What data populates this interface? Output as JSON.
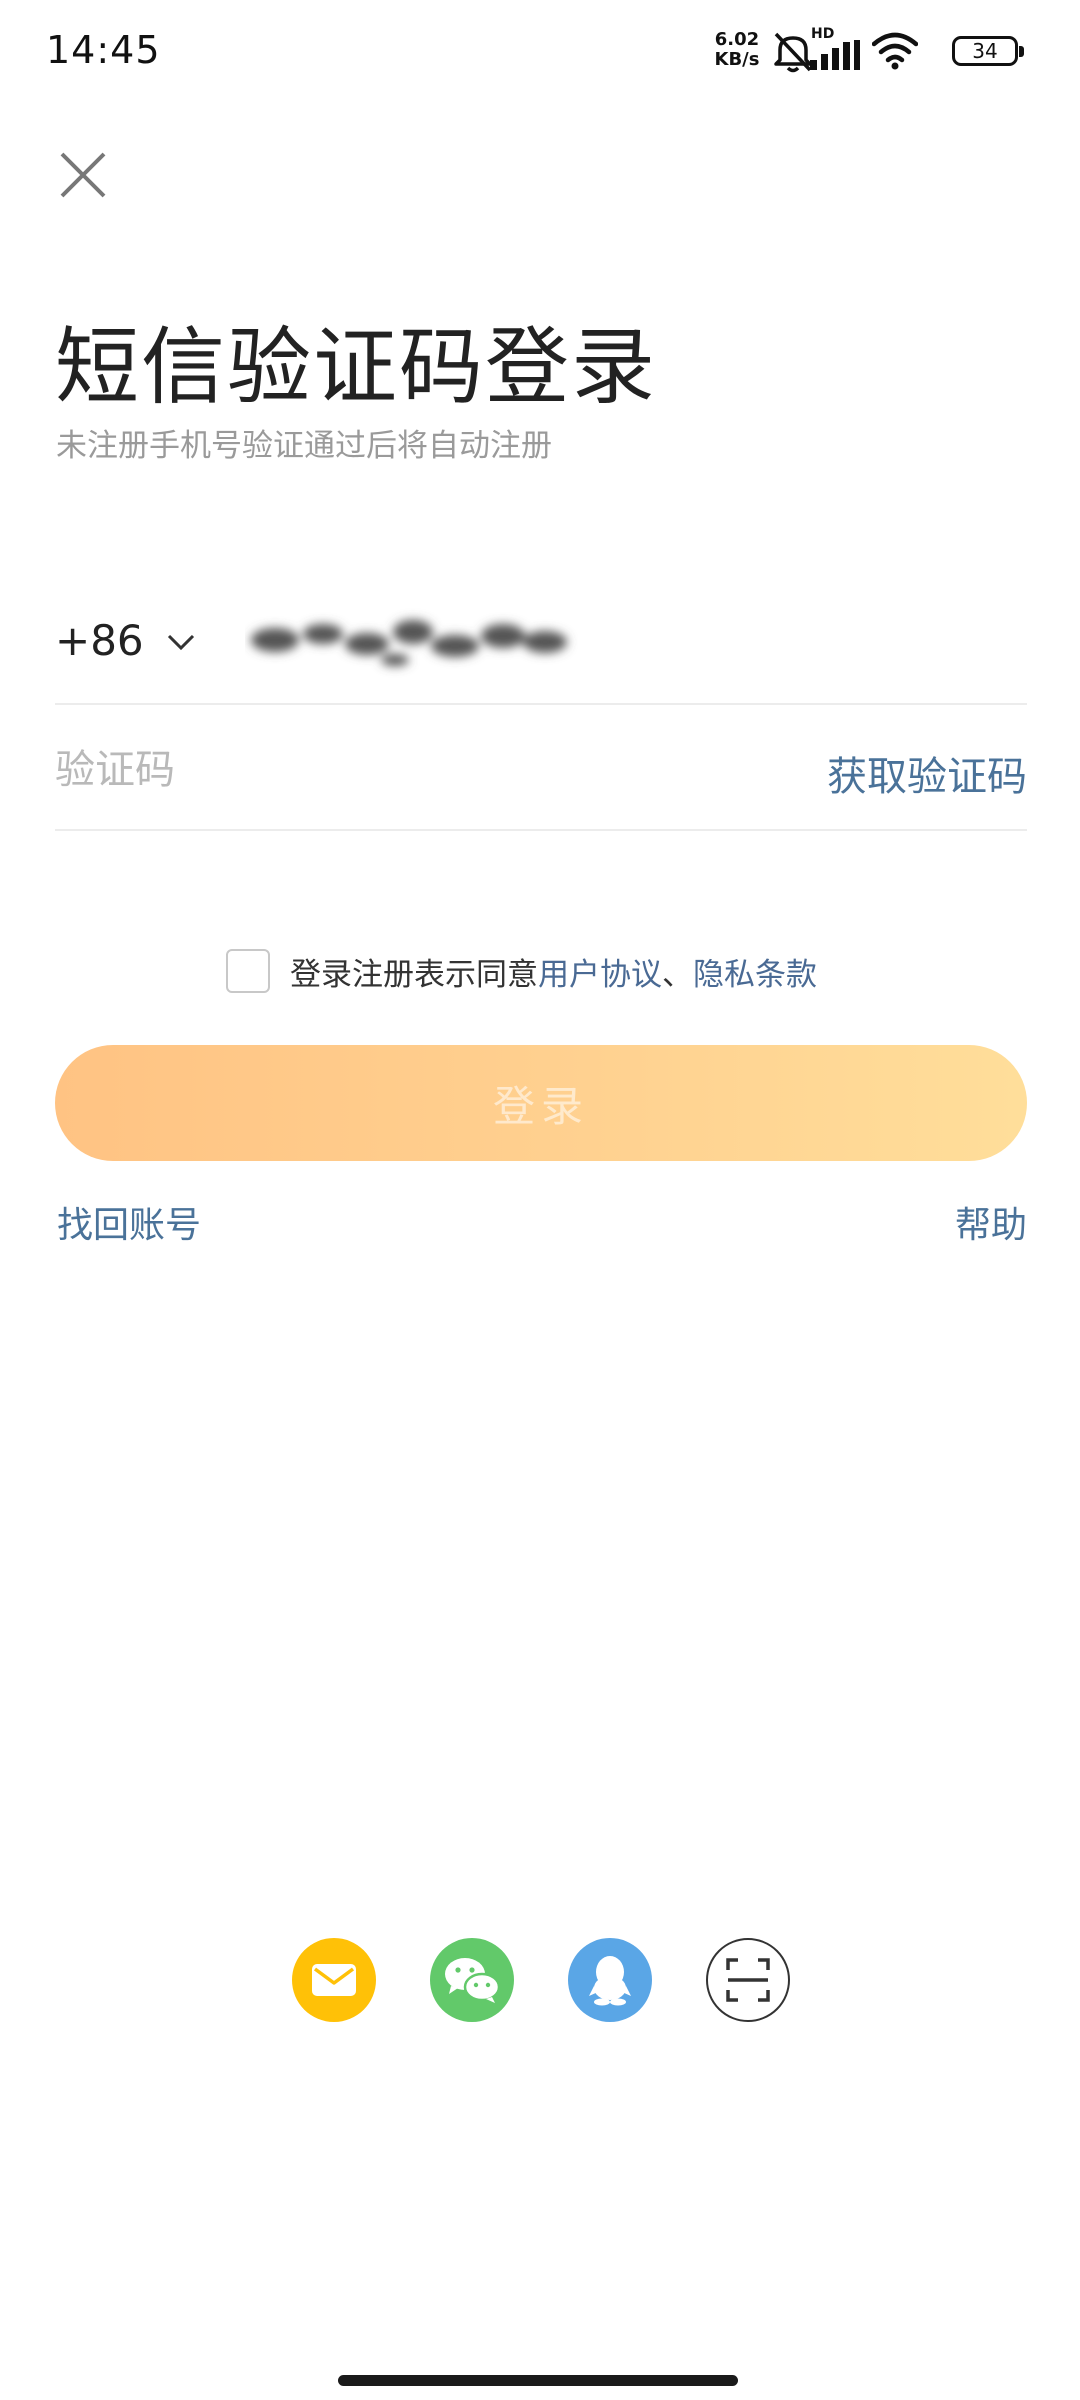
{
  "status_bar": {
    "time": "14:45",
    "net_speed_value": "6.02",
    "net_speed_unit": "KB/s",
    "hd_label": "HD",
    "battery": "34",
    "icons": [
      "mute-icon",
      "signal-icon",
      "wifi-icon",
      "battery-icon"
    ]
  },
  "header": {
    "close_icon": "close-icon",
    "title": "短信验证码登录",
    "subtitle": "未注册手机号验证通过后将自动注册"
  },
  "form": {
    "country_code": "+86",
    "phone_value_obscured": true,
    "code_placeholder": "验证码",
    "get_code_label": "获取验证码"
  },
  "agreement": {
    "checked": false,
    "prefix": "登录注册表示同意",
    "user_agreement": "用户协议",
    "separator": "、",
    "privacy": "隐私条款"
  },
  "login": {
    "label": "登录",
    "enabled": false
  },
  "links": {
    "recover": "找回账号",
    "help": "帮助"
  },
  "social": [
    {
      "icon": "mail-icon",
      "color": "#ffc107"
    },
    {
      "icon": "wechat-icon",
      "color": "#62c96a"
    },
    {
      "icon": "qq-icon",
      "color": "#5aa6e6"
    },
    {
      "icon": "scan-icon",
      "color": "#ffffff"
    }
  ],
  "colors": {
    "link": "#4a7299",
    "button_start": "#ffc383",
    "button_end": "#ffde9a"
  }
}
